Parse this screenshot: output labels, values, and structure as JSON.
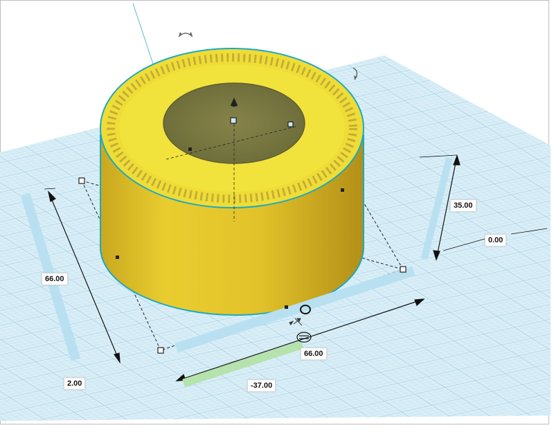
{
  "dimensions": {
    "height": "35.00",
    "elevation": "0.00",
    "depth": "66.00",
    "width": "66.00",
    "x_position": "-37.00",
    "y_position": "2.00"
  },
  "colors": {
    "grid_fill": "#d6ecf5",
    "grid_line": "#9fcbe0",
    "grid_major": "#7fb6d1",
    "shape_top": "#f2e23c",
    "shape_side": "#e3c52a",
    "shape_side_dark": "#b8961a",
    "hole_fill": "#7a7a3c",
    "selection_edge": "#1aa9c4",
    "ruler_blue": "#8ec9e6",
    "ruler_green": "#9ad48f"
  },
  "icons": [
    "rotate-around-top-icon",
    "rotate-around-side-icon",
    "lift-cone-icon",
    "rotate-circle-handle-icon",
    "move-arrows-icon"
  ]
}
